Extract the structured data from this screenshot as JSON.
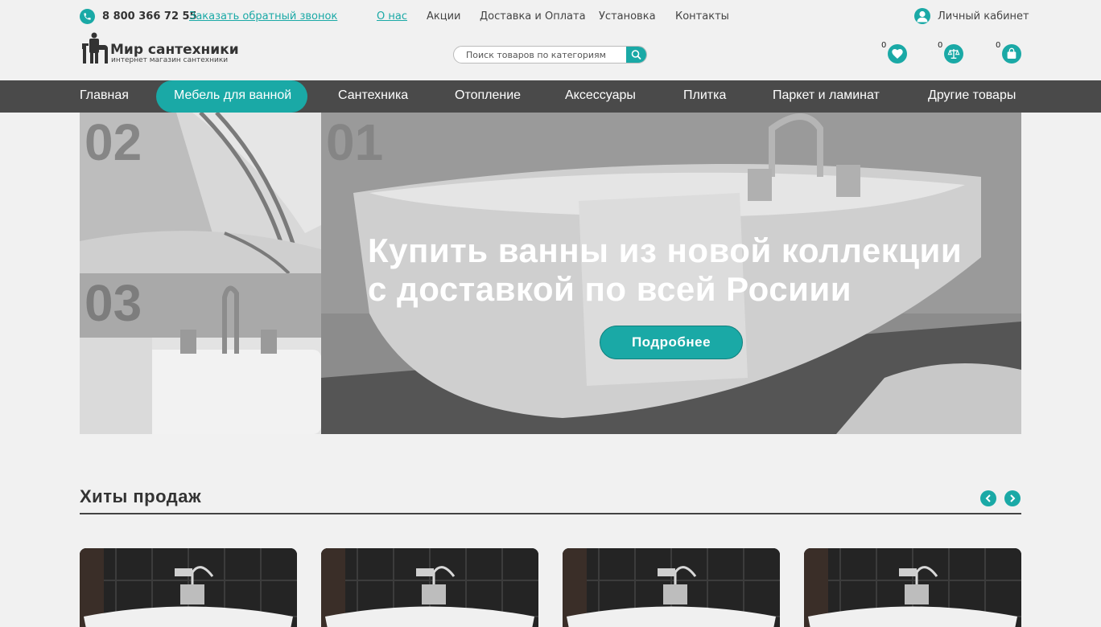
{
  "topbar": {
    "phone": "8 800 366 72 55",
    "callback_label": "Заказать обратный звонок",
    "nav": [
      "О нас",
      "Акции",
      "Доставка и Оплата",
      "Установка",
      "Контакты"
    ],
    "account_label": "Личный кабинет"
  },
  "logo": {
    "title": "Мир сантехники",
    "subtitle": "интернет магазин сантехники"
  },
  "search": {
    "placeholder": "Поиск товаров по категориям"
  },
  "header_icons": {
    "favorites_count": "0",
    "compare_count": "0",
    "cart_count": "0"
  },
  "main_nav": [
    "Главная",
    "Мебель для ванной",
    "Сантехника",
    "Отопление",
    "Аксессуары",
    "Плитка",
    "Паркет и ламинат",
    "Другие товары"
  ],
  "hero": {
    "thumbs": [
      "02",
      "03"
    ],
    "slide_number": "01",
    "headline_line1": "Купить ванны из новой коллекции",
    "headline_line2": "с доставкой по всей Росиии",
    "button_label": "Подробнее"
  },
  "bestsellers": {
    "title": "Хиты продаж"
  },
  "colors": {
    "accent": "#1aa9a6",
    "nav_bg": "#4a4a4a",
    "page_bg": "#f1f1f1"
  }
}
